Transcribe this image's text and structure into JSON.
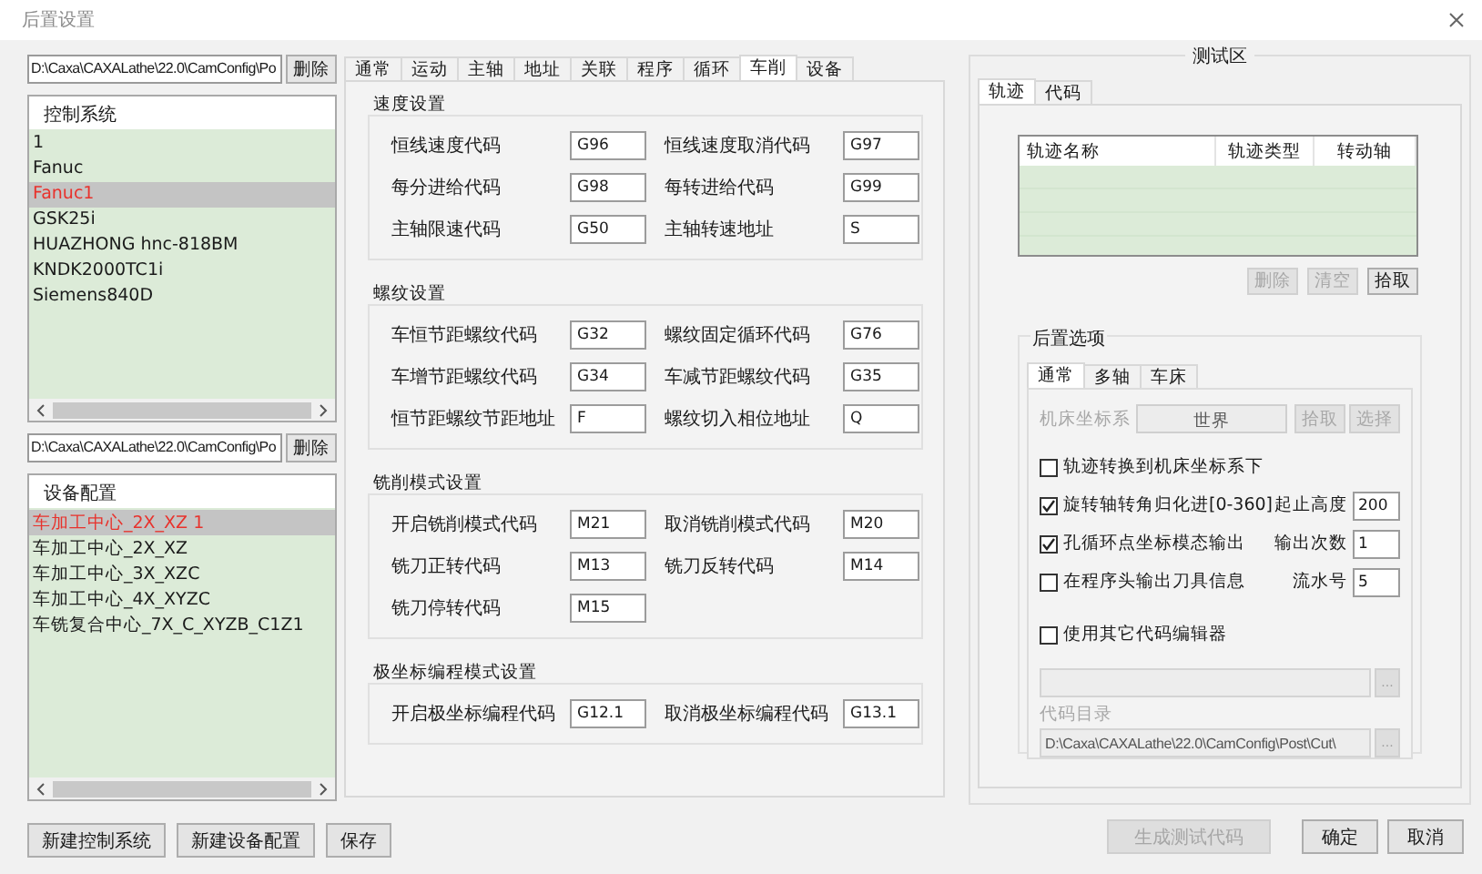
{
  "window": {
    "title": "后置设置"
  },
  "left": {
    "control_path": {
      "value": "D:\\Caxa\\CAXALathe\\22.0\\CamConfig\\Po",
      "button": "删除"
    },
    "control_list": {
      "header": "控制系统",
      "items": [
        {
          "label": "1",
          "selected": false
        },
        {
          "label": "Fanuc",
          "selected": false
        },
        {
          "label": "Fanuc1",
          "selected": true
        },
        {
          "label": "GSK25i",
          "selected": false
        },
        {
          "label": "HUAZHONG hnc-818BM",
          "selected": false
        },
        {
          "label": "KNDK2000TC1i",
          "selected": false
        },
        {
          "label": "Siemens840D",
          "selected": false
        }
      ]
    },
    "device_path": {
      "value": "D:\\Caxa\\CAXALathe\\22.0\\CamConfig\\Po",
      "button": "删除"
    },
    "device_list": {
      "header": "设备配置",
      "items": [
        {
          "label": "车加工中心_2X_XZ 1",
          "selected": true
        },
        {
          "label": "车加工中心_2X_XZ",
          "selected": false
        },
        {
          "label": "车加工中心_3X_XZC",
          "selected": false
        },
        {
          "label": "车加工中心_4X_XYZC",
          "selected": false
        },
        {
          "label": "车铣复合中心_7X_C_XYZB_C1Z1",
          "selected": false
        }
      ]
    },
    "buttons": [
      "新建控制系统",
      "新建设备配置",
      "保存"
    ]
  },
  "tabs": [
    {
      "label": "通常",
      "selected": false
    },
    {
      "label": "运动",
      "selected": false
    },
    {
      "label": "主轴",
      "selected": false
    },
    {
      "label": "地址",
      "selected": false
    },
    {
      "label": "关联",
      "selected": false
    },
    {
      "label": "程序",
      "selected": false
    },
    {
      "label": "循环",
      "selected": false
    },
    {
      "label": "车削",
      "selected": true
    },
    {
      "label": "设备",
      "selected": false
    }
  ],
  "groups": [
    {
      "title": "速度设置",
      "rows": [
        {
          "fields": [
            {
              "label": "恒线速度代码",
              "value": "G96"
            },
            {
              "label": "恒线速度取消代码",
              "value": "G97"
            }
          ]
        },
        {
          "fields": [
            {
              "label": "每分进给代码",
              "value": "G98"
            },
            {
              "label": "每转进给代码",
              "value": "G99"
            }
          ]
        },
        {
          "fields": [
            {
              "label": "主轴限速代码",
              "value": "G50"
            },
            {
              "label": "主轴转速地址",
              "value": "S"
            }
          ]
        }
      ]
    },
    {
      "title": "螺纹设置",
      "rows": [
        {
          "fields": [
            {
              "label": "车恒节距螺纹代码",
              "value": "G32"
            },
            {
              "label": "螺纹固定循环代码",
              "value": "G76"
            }
          ]
        },
        {
          "fields": [
            {
              "label": "车增节距螺纹代码",
              "value": "G34"
            },
            {
              "label": "车减节距螺纹代码",
              "value": "G35"
            }
          ]
        },
        {
          "fields": [
            {
              "label": "恒节距螺纹节距地址",
              "value": "F"
            },
            {
              "label": "螺纹切入相位地址",
              "value": "Q"
            }
          ]
        }
      ]
    },
    {
      "title": "铣削模式设置",
      "rows": [
        {
          "fields": [
            {
              "label": "开启铣削模式代码",
              "value": "M21"
            },
            {
              "label": "取消铣削模式代码",
              "value": "M20"
            }
          ]
        },
        {
          "fields": [
            {
              "label": "铣刀正转代码",
              "value": "M13"
            },
            {
              "label": "铣刀反转代码",
              "value": "M14"
            }
          ]
        },
        {
          "fields": [
            {
              "label": "铣刀停转代码",
              "value": "M15"
            }
          ]
        }
      ]
    },
    {
      "title": "极坐标编程模式设置",
      "rows": [
        {
          "fields": [
            {
              "label": "开启极坐标编程代码",
              "value": "G12.1"
            },
            {
              "label": "取消极坐标编程代码",
              "value": "G13.1"
            }
          ]
        }
      ]
    }
  ],
  "test_area": {
    "title": "测试区",
    "tabs": [
      {
        "label": "轨迹",
        "selected": true
      },
      {
        "label": "代码",
        "selected": false
      }
    ],
    "table": {
      "columns": [
        "轨迹名称",
        "轨迹类型",
        "转动轴"
      ]
    },
    "buttons": [
      {
        "label": "删除",
        "disabled": true
      },
      {
        "label": "清空",
        "disabled": true
      },
      {
        "label": "拾取",
        "disabled": false
      }
    ],
    "options": {
      "title": "后置选项",
      "tabs": [
        {
          "label": "通常",
          "selected": true
        },
        {
          "label": "多轴",
          "selected": false
        },
        {
          "label": "车床",
          "selected": false
        }
      ],
      "coord": {
        "label": "机床坐标系",
        "value": "世界",
        "disabled": true,
        "buttons": [
          {
            "label": "拾取",
            "disabled": true
          },
          {
            "label": "选择",
            "disabled": true
          }
        ]
      },
      "checks": [
        {
          "label": "轨迹转换到机床坐标系下",
          "checked": false
        },
        {
          "label": "旋转轴转角归化进[0-360]",
          "checked": true,
          "field_label": "起止高度",
          "value": "200"
        },
        {
          "label": "孔循环点坐标模态输出",
          "checked": true,
          "field_label": "输出次数",
          "value": "1"
        },
        {
          "label": "在程序头输出刀具信息",
          "checked": false,
          "field_label": "流水号",
          "value": "5"
        }
      ],
      "editor": {
        "label": "使用其它代码编辑器",
        "checked": false,
        "disabled": true,
        "browse": "..."
      },
      "code_dir": {
        "label": "代码目录",
        "value": "D:\\Caxa\\CAXALathe\\22.0\\CamConfig\\Post\\Cut\\",
        "disabled": true,
        "browse": "..."
      }
    }
  },
  "footer": [
    {
      "label": "生成测试代码",
      "disabled": true
    },
    {
      "label": "确定",
      "disabled": false
    },
    {
      "label": "取消",
      "disabled": false
    }
  ]
}
